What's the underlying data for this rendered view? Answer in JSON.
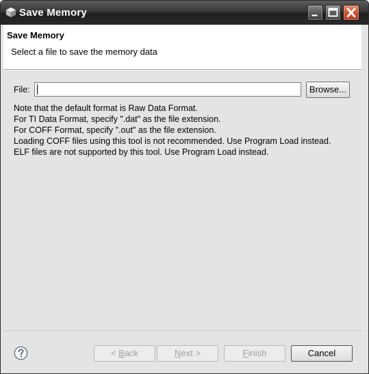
{
  "window": {
    "title": "Save Memory",
    "app_icon": "cube-icon",
    "controls": {
      "minimize": "minimize-icon",
      "maximize": "maximize-icon",
      "close": "close-icon"
    },
    "close_color": "#d0502e"
  },
  "header": {
    "title": "Save Memory",
    "description": "Select a file to save the memory data"
  },
  "form": {
    "file_label": "File:",
    "file_value": "",
    "browse_label": "Browse...",
    "notes": [
      "Note that the default format is Raw Data Format.",
      "For TI Data Format, specify \".dat\" as the file extension.",
      "For COFF Format, specify \".out\" as the file extension.",
      "Loading COFF files using this tool is not recommended. Use Program Load instead.",
      "ELF files are not supported by this tool. Use Program Load instead."
    ]
  },
  "footer": {
    "help_icon": "help-icon",
    "back": {
      "arrow": "< ",
      "mnemonic": "B",
      "rest": "ack",
      "enabled": false
    },
    "next": {
      "mnemonic": "N",
      "rest": "ext",
      "arrow": " >",
      "enabled": false
    },
    "finish": {
      "mnemonic": "F",
      "rest": "inish",
      "enabled": false
    },
    "cancel": {
      "label": "Cancel",
      "enabled": true
    }
  }
}
